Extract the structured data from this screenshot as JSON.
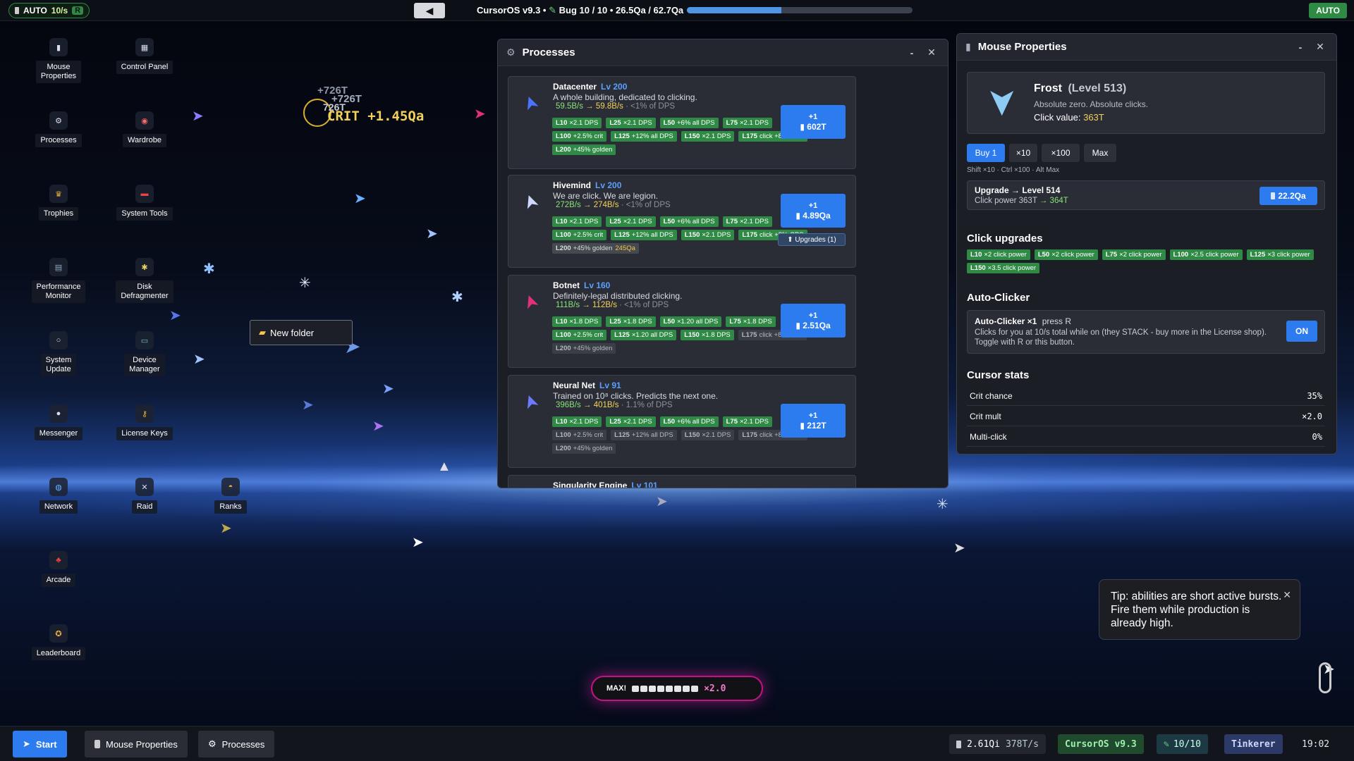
{
  "topbar": {
    "auto_label": "AUTO",
    "auto_rate": "10/s",
    "auto_key": "R",
    "back_icon": "◀",
    "title": "CursorOS v9.3 •",
    "bug_text": "Bug 10 / 10 • 26.5Qa / 62.7Qa",
    "progress": 0.42,
    "auto_right": "AUTO"
  },
  "desktop": {
    "icons": [
      {
        "label": "Mouse\nProperties",
        "icon": "mouse-icon"
      },
      {
        "label": "Control Panel",
        "icon": "control-panel-icon"
      },
      {
        "label": "Processes",
        "icon": "gear-icon"
      },
      {
        "label": "Wardrobe",
        "icon": "wardrobe-icon"
      },
      {
        "label": "Trophies",
        "icon": "trophy-icon"
      },
      {
        "label": "System Tools",
        "icon": "toolbox-icon"
      },
      {
        "label": "Performance\nMonitor",
        "icon": "chart-icon"
      },
      {
        "label": "Disk\nDefragmenter",
        "icon": "puzzle-icon"
      },
      {
        "label": "System\nUpdate",
        "icon": "update-icon"
      },
      {
        "label": "Device\nManager",
        "icon": "monitor-icon"
      },
      {
        "label": "Messenger",
        "icon": "chat-icon"
      },
      {
        "label": "License Keys",
        "icon": "key-icon"
      },
      {
        "label": "Network",
        "icon": "globe-icon"
      },
      {
        "label": "Raid",
        "icon": "swords-icon"
      },
      {
        "label": "Ranks",
        "icon": "medal-icon"
      },
      {
        "label": "Arcade",
        "icon": "joystick-icon"
      },
      {
        "label": "Leaderboard",
        "icon": "ribbon-icon"
      }
    ],
    "folder_label": "New folder",
    "float_texts": [
      "+726T",
      "+726T",
      "726T",
      "CRIT +1.45Qa"
    ]
  },
  "processes": {
    "title": "Processes",
    "minimize": "-",
    "close": "✕",
    "items": [
      {
        "name": "Datacenter",
        "level": "Lv 200",
        "desc": "A whole building, dedicated to clicking.",
        "rate_from": "59.5B/s",
        "rate_to": "→ 59.8B/s",
        "share": "· <1% of DPS",
        "buy_top": "+1",
        "buy_cost": "602T",
        "tags": [
          {
            "k": "L10",
            "v": "×2.1 DPS",
            "s": "on"
          },
          {
            "k": "L25",
            "v": "×2.1 DPS",
            "s": "on"
          },
          {
            "k": "L50",
            "v": "+6% all DPS",
            "s": "on"
          },
          {
            "k": "L75",
            "v": "×2.1 DPS",
            "s": "on"
          },
          {
            "k": "L100",
            "v": "+2.5% crit",
            "s": "on"
          },
          {
            "k": "L125",
            "v": "+12% all DPS",
            "s": "on"
          },
          {
            "k": "L150",
            "v": "×2.1 DPS",
            "s": "on"
          },
          {
            "k": "L175",
            "v": "click +8% CPS",
            "s": "on"
          },
          {
            "k": "L200",
            "v": "+45% golden",
            "s": "on"
          }
        ]
      },
      {
        "name": "Hivemind",
        "level": "Lv 200",
        "desc": "We are click. We are legion.",
        "rate_from": "272B/s",
        "rate_to": "→ 274B/s",
        "share": "· <1% of DPS",
        "buy_top": "+1",
        "buy_cost": "4.89Qa",
        "upgrades": "⬆ Upgrades (1)",
        "tags": [
          {
            "k": "L10",
            "v": "×2.1 DPS",
            "s": "on"
          },
          {
            "k": "L25",
            "v": "×2.1 DPS",
            "s": "on"
          },
          {
            "k": "L50",
            "v": "+6% all DPS",
            "s": "on"
          },
          {
            "k": "L75",
            "v": "×2.1 DPS",
            "s": "on"
          },
          {
            "k": "L100",
            "v": "+2.5% crit",
            "s": "on"
          },
          {
            "k": "L125",
            "v": "+12% all DPS",
            "s": "on"
          },
          {
            "k": "L150",
            "v": "×2.1 DPS",
            "s": "on"
          },
          {
            "k": "L175",
            "v": "click +8% CPS",
            "s": "on"
          },
          {
            "k": "L200",
            "v": "+45% golden",
            "s": "gold",
            "cost": "245Qa"
          }
        ]
      },
      {
        "name": "Botnet",
        "level": "Lv 160",
        "desc": "Definitely-legal distributed clicking.",
        "rate_from": "111B/s",
        "rate_to": "→ 112B/s",
        "share": "· <1% of DPS",
        "buy_top": "+1",
        "buy_cost": "2.51Qa",
        "tags": [
          {
            "k": "L10",
            "v": "×1.8 DPS",
            "s": "on"
          },
          {
            "k": "L25",
            "v": "×1.8 DPS",
            "s": "on"
          },
          {
            "k": "L50",
            "v": "×1.20 all DPS",
            "s": "on"
          },
          {
            "k": "L75",
            "v": "×1.8 DPS",
            "s": "on"
          },
          {
            "k": "L100",
            "v": "+2.5% crit",
            "s": "on"
          },
          {
            "k": "L125",
            "v": "×1.20 all DPS",
            "s": "on"
          },
          {
            "k": "L150",
            "v": "×1.8 DPS",
            "s": "on"
          },
          {
            "k": "L175",
            "v": "click +8% CPS",
            "s": "off"
          },
          {
            "k": "L200",
            "v": "+45% golden",
            "s": "off"
          }
        ]
      },
      {
        "name": "Neural Net",
        "level": "Lv 91",
        "desc": "Trained on 10⁸ clicks. Predicts the next one.",
        "rate_from": "396B/s",
        "rate_to": "→ 401B/s",
        "share": "· 1.1% of DPS",
        "buy_top": "+1",
        "buy_cost": "212T",
        "tags": [
          {
            "k": "L10",
            "v": "×2.1 DPS",
            "s": "on"
          },
          {
            "k": "L25",
            "v": "×2.1 DPS",
            "s": "on"
          },
          {
            "k": "L50",
            "v": "+6% all DPS",
            "s": "on"
          },
          {
            "k": "L75",
            "v": "×2.1 DPS",
            "s": "on"
          },
          {
            "k": "L100",
            "v": "+2.5% crit",
            "s": "off"
          },
          {
            "k": "L125",
            "v": "+12% all DPS",
            "s": "off"
          },
          {
            "k": "L150",
            "v": "×2.1 DPS",
            "s": "off"
          },
          {
            "k": "L175",
            "v": "click +8% CPS",
            "s": "off"
          },
          {
            "k": "L200",
            "v": "+45% golden",
            "s": "off"
          }
        ]
      },
      {
        "name": "Singularity Engine",
        "level": "Lv 101"
      }
    ]
  },
  "mouse": {
    "title": "Mouse Properties",
    "minimize": "-",
    "close": "✕",
    "cursor_name": "Frost",
    "cursor_level": "(Level 513)",
    "cursor_desc": "Absolute zero. Absolute clicks.",
    "click_value_label": "Click value:",
    "click_value": "363T",
    "buy_tabs": [
      "Buy 1",
      "×10",
      "×100",
      "Max"
    ],
    "hint": "Shift ×10 · Ctrl ×100 · Alt Max",
    "upgrade_title": "Upgrade → Level 514",
    "upgrade_power_label": "Click power",
    "upgrade_from": "363T",
    "upgrade_to": "→  364T",
    "upgrade_cost": "22.2Qa",
    "click_upgrades_title": "Click upgrades",
    "click_upgrades": [
      {
        "k": "L10",
        "v": "×2 click power"
      },
      {
        "k": "L50",
        "v": "×2 click power"
      },
      {
        "k": "L75",
        "v": "×2 click power"
      },
      {
        "k": "L100",
        "v": "×2.5 click power"
      },
      {
        "k": "L125",
        "v": "×3 click power"
      },
      {
        "k": "L150",
        "v": "×3.5 click power"
      }
    ],
    "autoclicker_title": "Auto-Clicker",
    "autoclicker_name": "Auto-Clicker ×1",
    "autoclicker_key": "press R",
    "autoclicker_desc": "Clicks for you at 10/s total while on (they STACK - buy more in the License shop). Toggle with R or this button.",
    "autoclicker_toggle": "ON",
    "stats_title": "Cursor stats",
    "stats": [
      {
        "label": "Crit chance",
        "value": "35%"
      },
      {
        "label": "Crit mult",
        "value": "×2.0"
      },
      {
        "label": "Multi-click",
        "value": "0%"
      }
    ]
  },
  "combo": {
    "label": "MAX!",
    "mult": "×2.0"
  },
  "tip": {
    "text": "Tip: abilities are short active bursts. Fire them while production is already high.",
    "close": "✕"
  },
  "taskbar": {
    "start": "Start",
    "tasks": [
      "Mouse Properties",
      "Processes"
    ],
    "balance": "2.61Qi",
    "rate": "378T/s",
    "os": "CursorOS v9.3",
    "bugs": "10/10",
    "rank": "Tinkerer",
    "clock": "19:02"
  },
  "colors": {
    "accent": "#2c7cf0",
    "upgrade_green": "#2f8a45",
    "level_blue": "#5aa0ff",
    "combo": "#c01684"
  }
}
